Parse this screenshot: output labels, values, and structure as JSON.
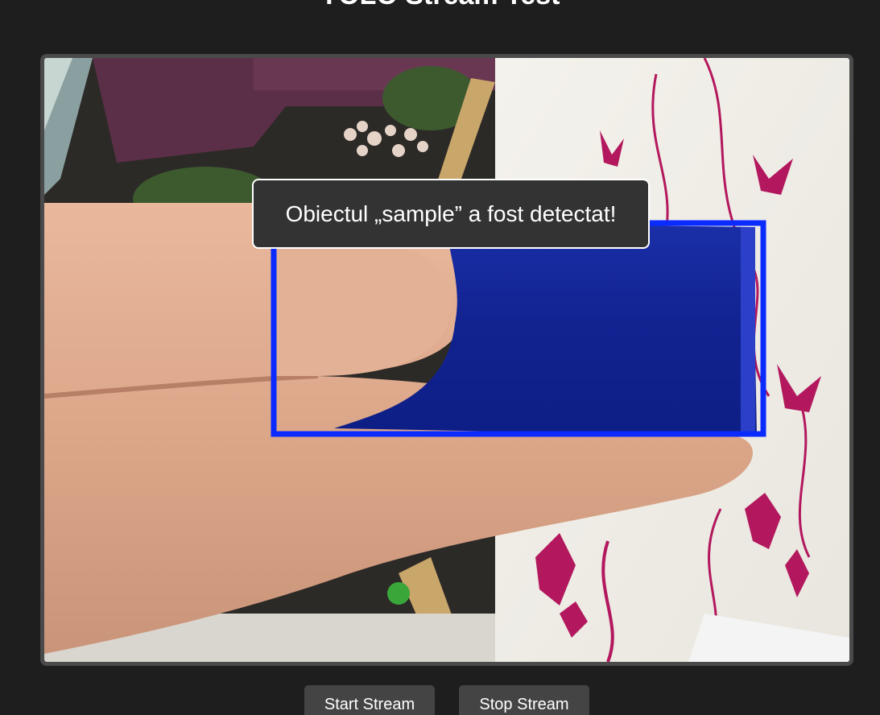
{
  "page": {
    "title": "YOLO Stream Test"
  },
  "detection": {
    "message": "Obiectul „sample” a fost detectat!",
    "box_color": "#0a2bff"
  },
  "controls": {
    "start_label": "Start Stream",
    "stop_label": "Stop Stream"
  },
  "colors": {
    "background": "#1e1e1e",
    "frame_border": "#4a4a4a",
    "button_bg": "#444444",
    "toast_bg": "#333333"
  }
}
